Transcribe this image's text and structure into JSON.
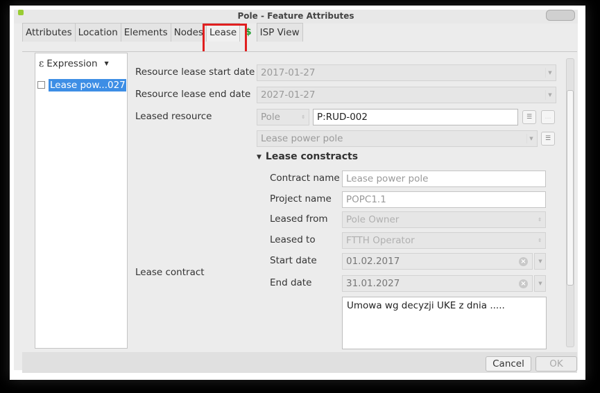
{
  "window": {
    "title": "Pole - Feature Attributes"
  },
  "tabs": [
    "Attributes",
    "Location",
    "Elements",
    "Nodes",
    "Lease",
    "$",
    "ISP View"
  ],
  "left": {
    "expression_label": "Expression",
    "list_item": "Lease pow...027"
  },
  "form": {
    "start_label": "Resource lease start date",
    "start_value": "2017-01-27",
    "end_label": "Resource lease end date",
    "end_value": "2027-01-27",
    "leased_resource_label": "Leased resource",
    "resource_type": "Pole",
    "resource_id": "P:RUD-002",
    "lease_select": "Lease power pole",
    "lease_contract_label": "Lease contract",
    "section_title": "Lease constracts",
    "contract_name_label": "Contract name",
    "contract_name_value": "Lease power pole",
    "project_name_label": "Project name",
    "project_name_value": "POPC1.1",
    "leased_from_label": "Leased from",
    "leased_from_value": "Pole Owner",
    "leased_to_label": "Leased to",
    "leased_to_value": "FTTH Operator",
    "start_date_label": "Start date",
    "start_date_value": "01.02.2017",
    "end_date_label": "End date",
    "end_date_value": "31.01.2027",
    "notes": "Umowa wg decyzji UKE z dnia ....."
  },
  "buttons": {
    "cancel": "Cancel",
    "ok": "OK"
  },
  "colors": {
    "highlight": "#e01f1f",
    "selection": "#3d8ee5",
    "dollar": "#1f9b2c"
  }
}
